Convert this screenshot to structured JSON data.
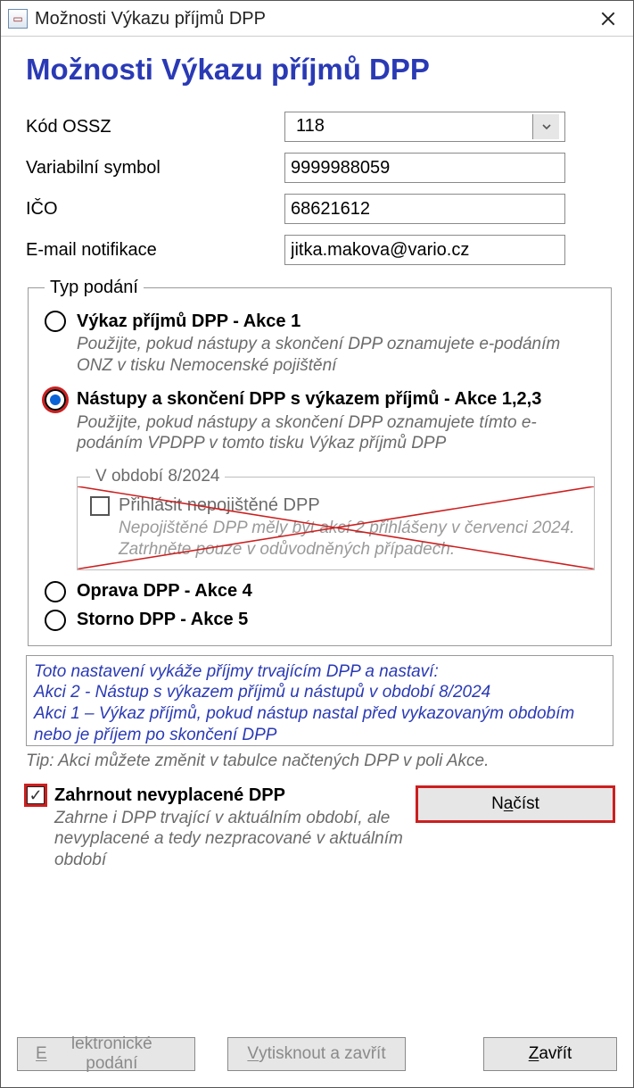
{
  "window": {
    "title": "Možnosti Výkazu příjmů DPP"
  },
  "page": {
    "heading": "Možnosti Výkazu příjmů DPP"
  },
  "fields": {
    "ossz_label": "Kód OSSZ",
    "ossz_value": "118",
    "varsym_label": "Variabilní symbol",
    "varsym_value": "9999988059",
    "ico_label": "IČO",
    "ico_value": "68621612",
    "email_label": "E-mail notifikace",
    "email_value": "jitka.makova@vario.cz"
  },
  "typ": {
    "legend": "Typ podání",
    "opt1_label": "Výkaz příjmů DPP - Akce 1",
    "opt1_help": "Použijte, pokud nástupy a skončení DPP oznamujete e-podáním ONZ v tisku Nemocenské pojištění",
    "opt2_label": "Nástupy a skončení DPP s výkazem příjmů - Akce 1,2,3",
    "opt2_help": "Použijte, pokud nástupy a skončení DPP oznamujete tímto e-podáním VPDPP v tomto tisku Výkaz příjmů DPP",
    "period_legend": "V období 8/2024",
    "period_check_label": "Přihlásit nepojištěné DPP",
    "period_check_help": "Nepojištěné DPP měly být akcí 2 přihlášeny v červenci 2024. Zatrhněte pouze v odůvodněných případech.",
    "opt3_label": "Oprava DPP - Akce 4",
    "opt4_label": "Storno DPP - Akce 5"
  },
  "info": {
    "line1": "Toto nastavení vykáže příjmy trvajícím DPP a nastaví:",
    "line2": "Akci 2 - Nástup s výkazem příjmů u nástupů v období 8/2024",
    "line3": "Akci 1 – Výkaz příjmů, pokud nástup nastal před vykazovaným obdobím nebo je příjem po skončení DPP"
  },
  "tip": "Tip: Akci můžete změnit v tabulce načtených DPP v poli Akce.",
  "include": {
    "label": "Zahrnout nevyplacené DPP",
    "help": "Zahrne i DPP trvající v aktuálním období, ale nevyplacené a tedy nezpracované v aktuálním období"
  },
  "buttons": {
    "load_pre": "N",
    "load_mn": "a",
    "load_post": "číst",
    "epodani_pre": "",
    "epodani_mn": "E",
    "epodani_post": "lektronické podání",
    "print_pre": "",
    "print_mn": "V",
    "print_post": "ytisknout a zavřít",
    "close_pre": "",
    "close_mn": "Z",
    "close_post": "avřít"
  }
}
